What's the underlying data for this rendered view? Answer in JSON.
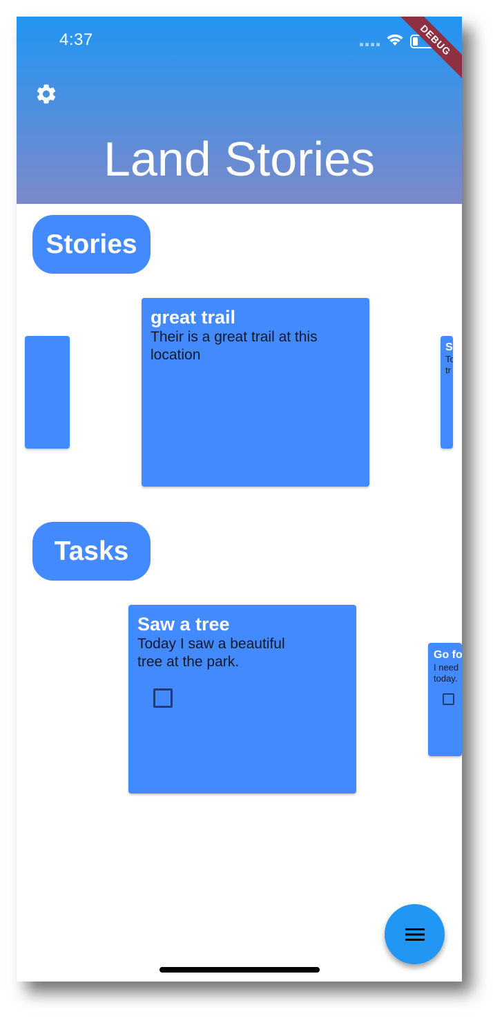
{
  "status_bar": {
    "time": "4:37",
    "debug_label": "DEBUG",
    "icons": [
      "signal-icon",
      "wifi-icon",
      "battery-icon"
    ]
  },
  "header": {
    "settings_icon": "gear-icon",
    "title": "Land Stories",
    "gradient_top": "#2196f3",
    "gradient_bottom": "#7c89c9"
  },
  "stories": {
    "heading": "Stories",
    "cards": [
      {
        "title": "great trail",
        "body": "Their is a great trail at this location"
      },
      {
        "title": "S",
        "body": "To tr"
      }
    ]
  },
  "tasks": {
    "heading": "Tasks",
    "cards": [
      {
        "title": "Saw a tree",
        "body": "Today I saw a beautiful tree at the park.",
        "checked": false
      },
      {
        "title": "Go fo",
        "body": "I need today.",
        "checked": false
      }
    ]
  },
  "fab": {
    "icon": "menu-icon"
  },
  "colors": {
    "accent": "#448aff",
    "fab": "#2196f3",
    "debug_ribbon": "#8e2f42"
  }
}
